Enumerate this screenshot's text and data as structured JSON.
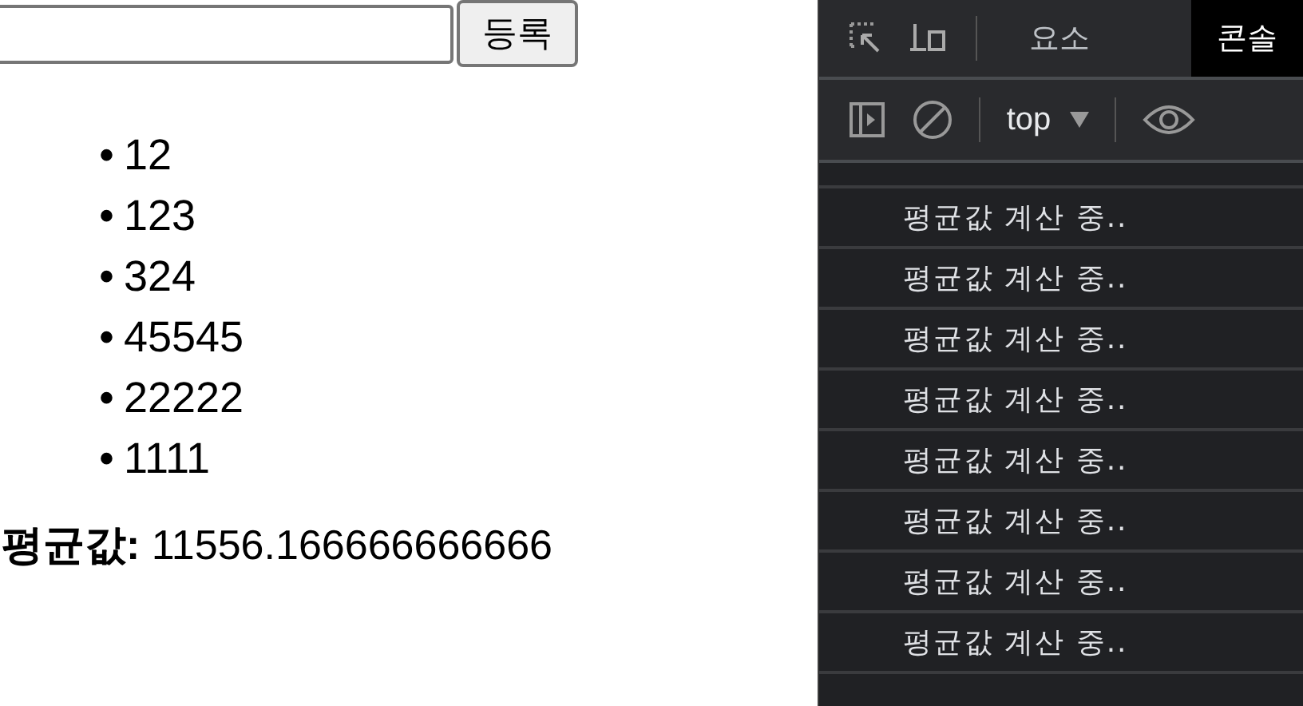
{
  "form": {
    "button": "등록"
  },
  "items": [
    {
      "bullet": "•",
      "text": "12"
    },
    {
      "bullet": "•",
      "text": "123"
    },
    {
      "bullet": "•",
      "text": "324"
    },
    {
      "bullet": "•",
      "text": "45545"
    },
    {
      "bullet": "•",
      "text": "22222"
    },
    {
      "bullet": "•",
      "text": "1111"
    }
  ],
  "average": {
    "label": "평균값:",
    "value": "11556.166666666666"
  },
  "devtools": {
    "tabs": [
      {
        "label": "요소",
        "selected": false
      },
      {
        "label": "콘솔",
        "selected": true
      }
    ],
    "context": "top",
    "messages": [
      "평균값 계산 중..",
      "평균값 계산 중..",
      "평균값 계산 중..",
      "평균값 계산 중..",
      "평균값 계산 중..",
      "평균값 계산 중..",
      "평균값 계산 중..",
      "평균값 계산 중.."
    ]
  }
}
